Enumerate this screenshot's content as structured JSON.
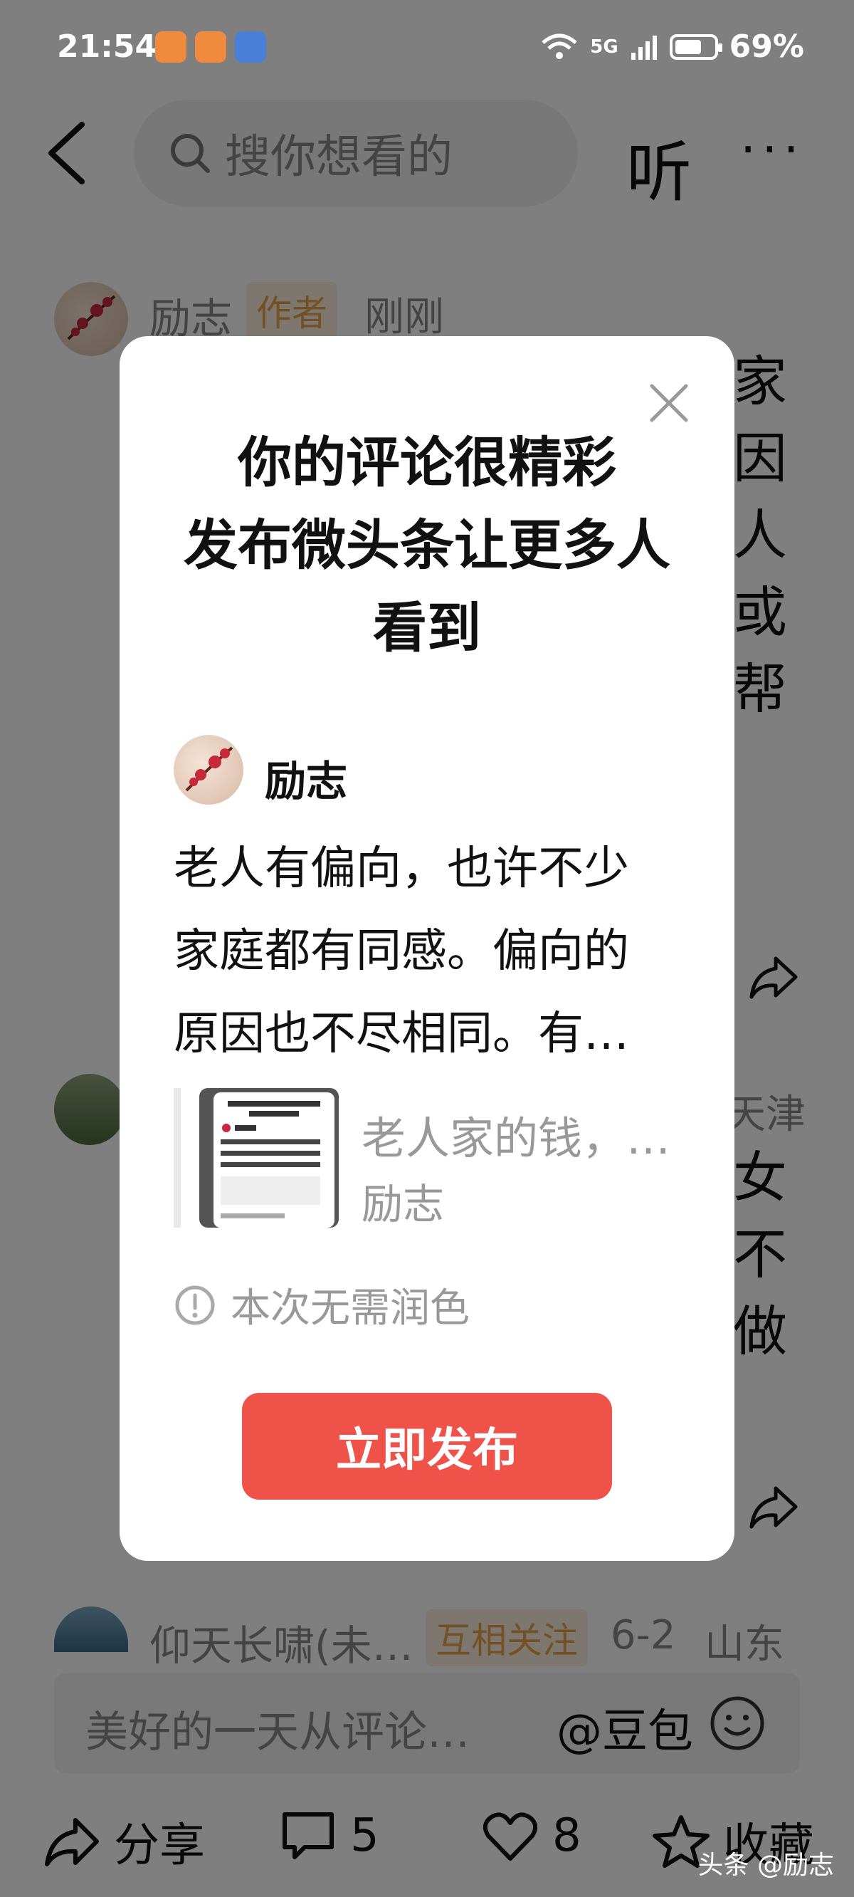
{
  "status_bar": {
    "time": "21:54",
    "network": "5G",
    "battery": "69%",
    "battery_level": 0.69
  },
  "nav": {
    "search_placeholder": "搜你想看的",
    "listen_label": "听",
    "more_label": "···"
  },
  "comments": [
    {
      "name": "励志",
      "badge": "作者",
      "time": "刚刚",
      "text_right": [
        "家",
        "因",
        "人",
        "或",
        "帮"
      ]
    },
    {
      "meta": "天津",
      "text_right": [
        "女",
        "不",
        "做"
      ]
    },
    {
      "name": "仰天长啸(未…",
      "badge": "互相关注",
      "date": "6-2",
      "location": "山东"
    }
  ],
  "input_bar": {
    "placeholder": "美好的一天从评论…",
    "mention": "@豆包"
  },
  "toolbar": {
    "share_label": "分享",
    "comment_count": "5",
    "like_count": "8",
    "favorite_label": "收藏"
  },
  "watermark": "头条 @励志",
  "modal": {
    "title_lines": [
      "你的评论很精彩",
      "发布微头条让更多人",
      "看到"
    ],
    "author": "励志",
    "body_lines": [
      "老人有偏向，也许不少",
      "家庭都有同感。偏向的",
      "原因也不尽相同。有…"
    ],
    "preview_title": "老人家的钱，…",
    "preview_author": "励志",
    "note": "本次无需润色",
    "publish_label": "立即发布"
  },
  "colors": {
    "accent": "#ef5248",
    "badge_author": "#e8a24a",
    "overlay": "rgba(0,0,0,0.5)"
  }
}
